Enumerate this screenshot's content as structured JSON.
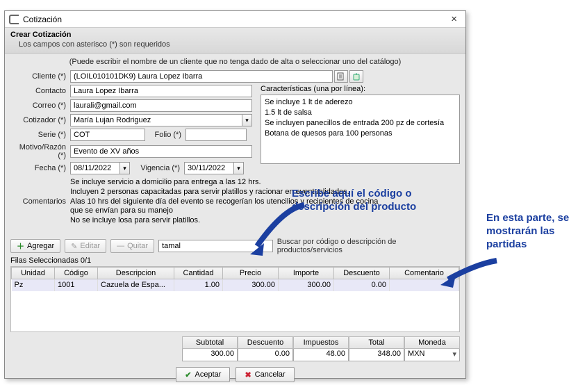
{
  "window": {
    "title": "Cotización",
    "close_glyph": "×"
  },
  "header": {
    "title": "Crear Cotización",
    "subtitle": "Los campos con asterisco (*) son requeridos"
  },
  "hint": "(Puede escribir el nombre de un cliente que no tenga dado de alta o seleccionar uno del catálogo)",
  "labels": {
    "cliente": "Cliente (*)",
    "contacto": "Contacto",
    "correo": "Correo (*)",
    "cotizador": "Cotizador (*)",
    "serie": "Serie (*)",
    "folio": "Folio (*)",
    "motivo": "Motivo/Razón (*)",
    "fecha": "Fecha (*)",
    "vigencia": "Vigencia (*)",
    "comentarios": "Comentarios",
    "caracteristicas": "Características (una por línea):"
  },
  "fields": {
    "cliente": "(LOIL010101DK9) Laura Lopez Ibarra",
    "contacto": "Laura Lopez Ibarra",
    "correo": "laurali@gmail.com",
    "cotizador": "María Lujan Rodriguez",
    "serie": "COT",
    "folio": "",
    "motivo": "Evento de XV años",
    "fecha": "08/11/2022",
    "vigencia": "30/11/2022",
    "comentarios": "Se incluye servicio a domicilio para entrega a las 12 hrs.\nIncluyen 2 personas capacitadas para servir platillos y racionar en eventualidades.\nAlas 10 hrs del siguiente día del evento se recogerían los utencilios y recipientes de cocina que se envían para su manejo\nNo se incluye losa para servir platillos.",
    "caracteristicas": "Se incluye 1 lt de aderezo\n1.5 lt de salsa\nSe incluyen panecillos de entrada 200 pz de cortesía\nBotana de quesos para 100 personas",
    "search": "tamal"
  },
  "toolbar": {
    "agregar": "Agregar",
    "editar": "Editar",
    "quitar": "Quitar",
    "search_hint": "Buscar por código o descripción de productos/servicios"
  },
  "rows_label": "Filas Seleccionadas 0/1",
  "grid": {
    "headers": {
      "unidad": "Unidad",
      "codigo": "Código",
      "descripcion": "Descripcion",
      "cantidad": "Cantidad",
      "precio": "Precio",
      "importe": "Importe",
      "descuento": "Descuento",
      "comentario": "Comentario"
    },
    "rows": [
      {
        "unidad": "Pz",
        "codigo": "1001",
        "descripcion": "Cazuela de Espa...",
        "cantidad": "1.00",
        "precio": "300.00",
        "importe": "300.00",
        "descuento": "0.00",
        "comentario": ""
      }
    ]
  },
  "totals": {
    "labels": {
      "subtotal": "Subtotal",
      "descuento": "Descuento",
      "impuestos": "Impuestos",
      "total": "Total",
      "moneda": "Moneda"
    },
    "values": {
      "subtotal": "300.00",
      "descuento": "0.00",
      "impuestos": "48.00",
      "total": "348.00",
      "moneda": "MXN"
    }
  },
  "footer": {
    "aceptar": "Aceptar",
    "cancelar": "Cancelar"
  },
  "callouts": {
    "c1": "Escribe aquí el código o descripción del producto",
    "c2": "En esta parte, se mostrarán las partidas"
  }
}
